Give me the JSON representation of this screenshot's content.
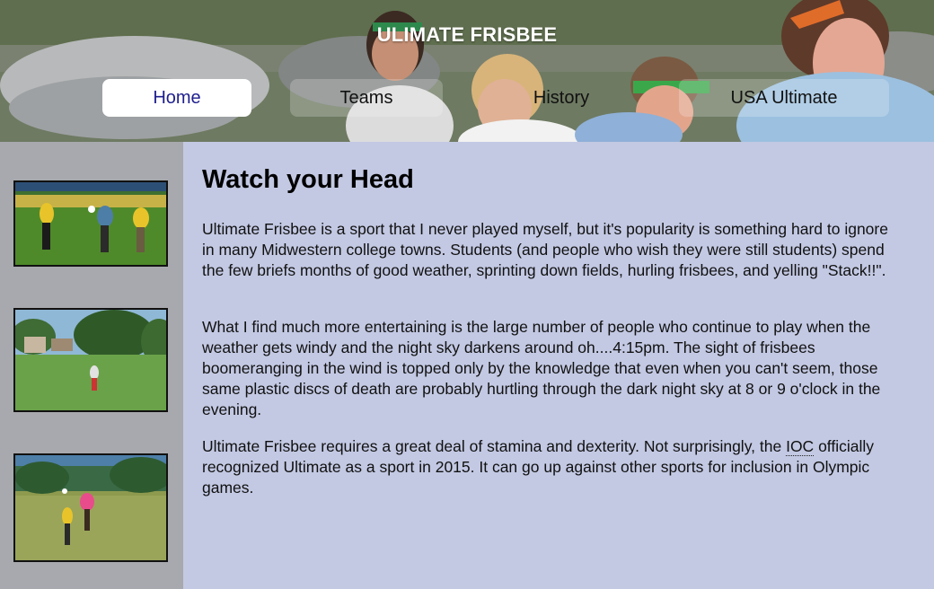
{
  "header": {
    "site_title": "ULIMATE FRISBEE"
  },
  "nav": {
    "items": [
      {
        "label": "Home",
        "active": true
      },
      {
        "label": "Teams",
        "active": false
      },
      {
        "label": "History",
        "active": false
      },
      {
        "label": "USA Ultimate",
        "active": false
      }
    ]
  },
  "main": {
    "title": "Watch your Head",
    "paragraph1": "Ultimate Frisbee is a sport that I never played myself, but it's popularity is something hard to ignore in many Midwestern college towns. Students (and people who wish they were still students) spend the few briefs months of good weather, sprinting down fields, hurling frisbees, and yelling \"Stack!!\".",
    "paragraph2": "What I find much more entertaining is the large number of people who continue to play when the weather gets windy and the night sky darkens around oh....4:15pm. The sight of frisbees boomeranging in the wind is topped only by the knowledge that even when you can't seem, those same plastic discs of death are probably hurtling through the dark night sky at 8 or 9 o'clock in the evening.",
    "paragraph3_before": "Ultimate Frisbee requires a great deal of stamina and dexterity. Not surprisingly, the ",
    "paragraph3_abbr": "IOC",
    "paragraph3_after": " officially recognized Ultimate as a sport in 2015. It can go up against other sports for inclusion in Olympic games."
  },
  "colors": {
    "main_background": "#c3c9e3",
    "sidebar_background": "#a7a9ae",
    "active_nav_text": "#1f1f8f"
  }
}
